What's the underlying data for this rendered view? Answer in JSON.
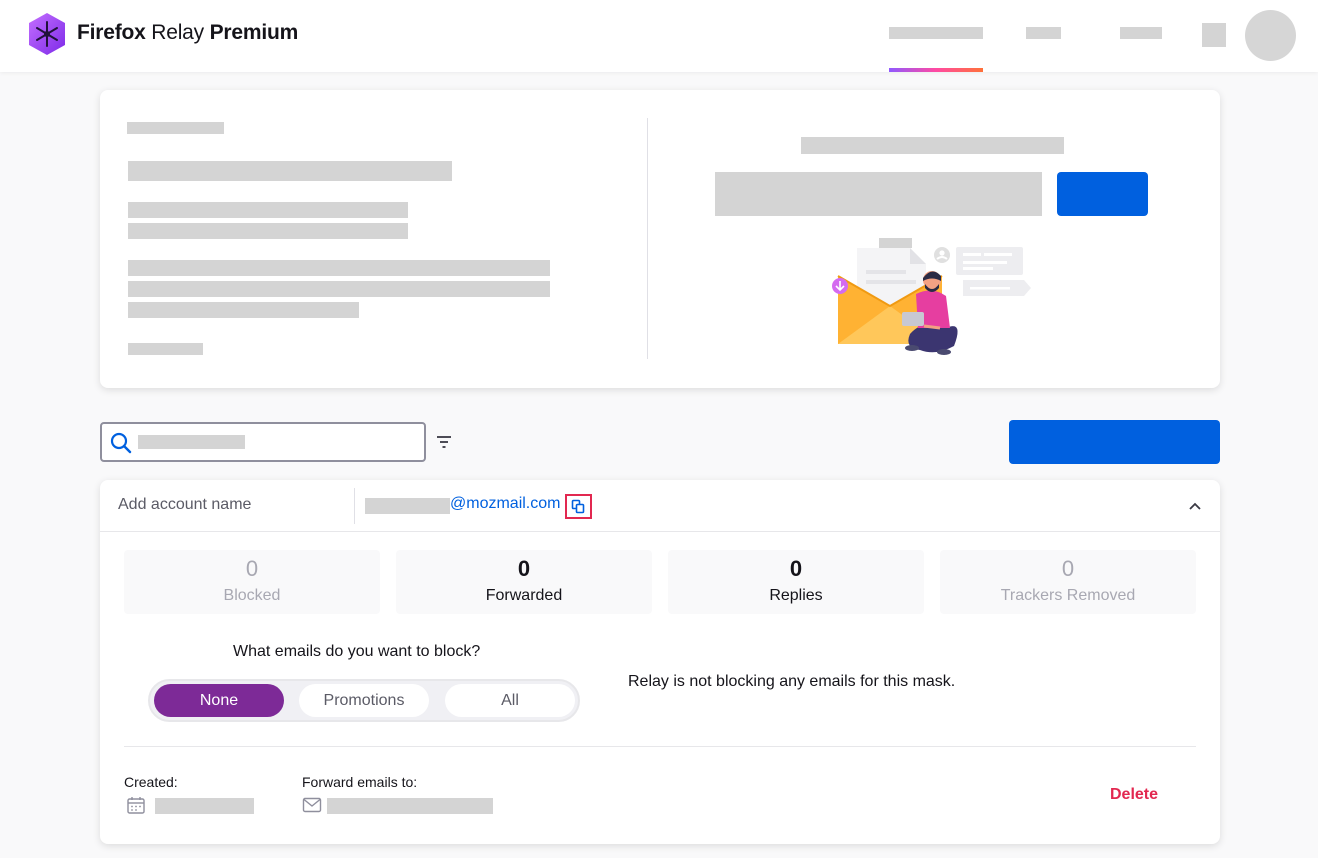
{
  "header": {
    "brand": {
      "firefox": "Firefox",
      "relay": "Relay",
      "premium": "Premium"
    }
  },
  "mask": {
    "account_name_placeholder": "Add account name",
    "address_domain": "@mozmail.com",
    "stats": [
      {
        "value": "0",
        "label": "Blocked",
        "state": "muted"
      },
      {
        "value": "0",
        "label": "Forwarded",
        "state": "active"
      },
      {
        "value": "0",
        "label": "Replies",
        "state": "active"
      },
      {
        "value": "0",
        "label": "Trackers Removed",
        "state": "muted"
      }
    ],
    "block_question": "What emails do you want to block?",
    "block_options": [
      "None",
      "Promotions",
      "All"
    ],
    "block_selected": "None",
    "block_status": "Relay is not blocking any emails for this mask.",
    "created_label": "Created:",
    "forward_label": "Forward emails to:",
    "delete_label": "Delete"
  },
  "colors": {
    "accent_blue": "#0060df",
    "selected_purple": "#7d2a97",
    "delete_red": "#e22850",
    "highlight_outline": "#e22850"
  },
  "icons": [
    "relay-logo-icon",
    "search-icon",
    "filter-icon",
    "copy-icon",
    "chevron-up-icon",
    "calendar-icon",
    "envelope-icon"
  ]
}
